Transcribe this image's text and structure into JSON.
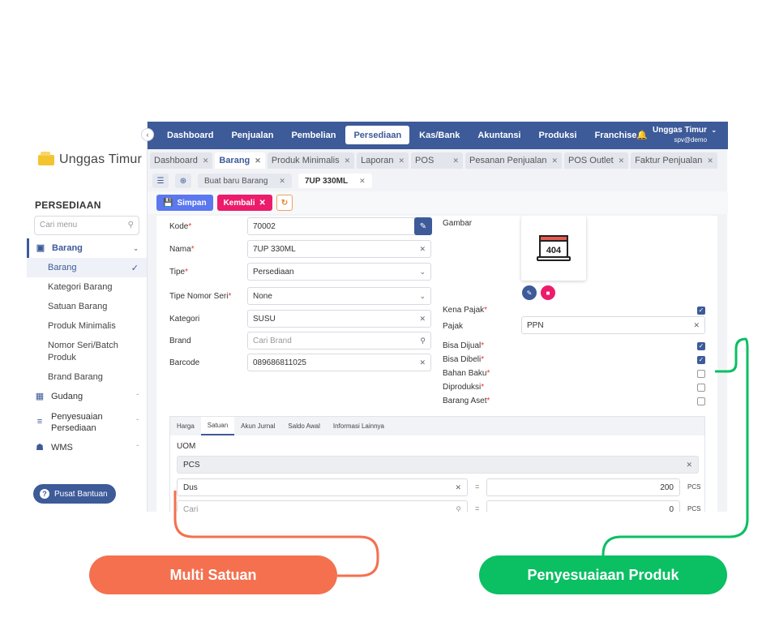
{
  "sidebar": {
    "logo_text": "Unggas Timur",
    "section_title": "PERSEDIAAN",
    "search_placeholder": "Cari menu",
    "groups": [
      {
        "label": "Barang",
        "icon": "box-icon",
        "expanded": true,
        "items": [
          {
            "label": "Barang",
            "selected": true
          },
          {
            "label": "Kategori Barang"
          },
          {
            "label": "Satuan Barang"
          },
          {
            "label": "Produk Minimalis"
          },
          {
            "label": "Nomor Seri/Batch Produk"
          },
          {
            "label": "Brand Barang"
          }
        ]
      },
      {
        "label": "Gudang",
        "icon": "warehouse-icon"
      },
      {
        "label": "Penyesuaian Persediaan",
        "icon": "adjust-icon"
      },
      {
        "label": "WMS",
        "icon": "building-icon"
      }
    ],
    "help_label": "Pusat Bantuan"
  },
  "topnav": {
    "items": [
      "Dashboard",
      "Penjualan",
      "Pembelian",
      "Persediaan",
      "Kas/Bank",
      "Akuntansi",
      "Produksi",
      "Franchise"
    ],
    "active": "Persediaan",
    "user_name": "Unggas Timur",
    "user_sub": "spv@demo"
  },
  "tabs": [
    "Dashboard",
    "Barang",
    "Produk Minimalis",
    "Laporan",
    "POS",
    "Pesanan Penjualan",
    "POS Outlet",
    "Faktur Penjualan"
  ],
  "active_tab": "Barang",
  "subtabs": [
    {
      "label": "Buat baru Barang",
      "active": false
    },
    {
      "label": "7UP 330ML",
      "active": true
    }
  ],
  "actions": {
    "save": "Simpan",
    "back": "Kembali"
  },
  "form": {
    "kode": {
      "label": "Kode",
      "value": "70002"
    },
    "nama": {
      "label": "Nama",
      "value": "7UP 330ML"
    },
    "tipe": {
      "label": "Tipe",
      "value": "Persediaan"
    },
    "tipe_nomor_seri": {
      "label": "Tipe Nomor Seri",
      "value": "None"
    },
    "kategori": {
      "label": "Kategori",
      "value": "SUSU"
    },
    "brand": {
      "label": "Brand",
      "placeholder": "Cari Brand"
    },
    "barcode": {
      "label": "Barcode",
      "value": "089686811025"
    },
    "gambar_label": "Gambar",
    "image_text": "404",
    "kena_pajak": {
      "label": "Kena Pajak",
      "checked": true
    },
    "pajak": {
      "label": "Pajak",
      "value": "PPN"
    },
    "bisa_dijual": {
      "label": "Bisa Dijual",
      "checked": true
    },
    "bisa_dibeli": {
      "label": "Bisa Dibeli",
      "checked": true
    },
    "bahan_baku": {
      "label": "Bahan Baku",
      "checked": false
    },
    "diproduksi": {
      "label": "Diproduksi",
      "checked": false
    },
    "barang_aset": {
      "label": "Barang Aset",
      "checked": false
    }
  },
  "detail_tabs": [
    "Harga",
    "Satuan",
    "Akun Jurnal",
    "Saldo Awal",
    "Informasi Lainnya"
  ],
  "active_detail_tab": "Satuan",
  "uom": {
    "label": "UOM",
    "base": "PCS",
    "rows": [
      {
        "unit": "Dus",
        "qty": "200",
        "base_unit": "PCS"
      },
      {
        "unit_placeholder": "Cari",
        "qty": "0",
        "base_unit": "PCS"
      }
    ]
  },
  "callouts": {
    "left": "Multi Satuan",
    "right": "Penyesuaiaan Produk"
  },
  "colors": {
    "primary": "#3d5a99",
    "danger": "#ec1c6b",
    "save": "#5b78f0",
    "callout_orange": "#f4704f",
    "callout_green": "#0bbf63"
  }
}
